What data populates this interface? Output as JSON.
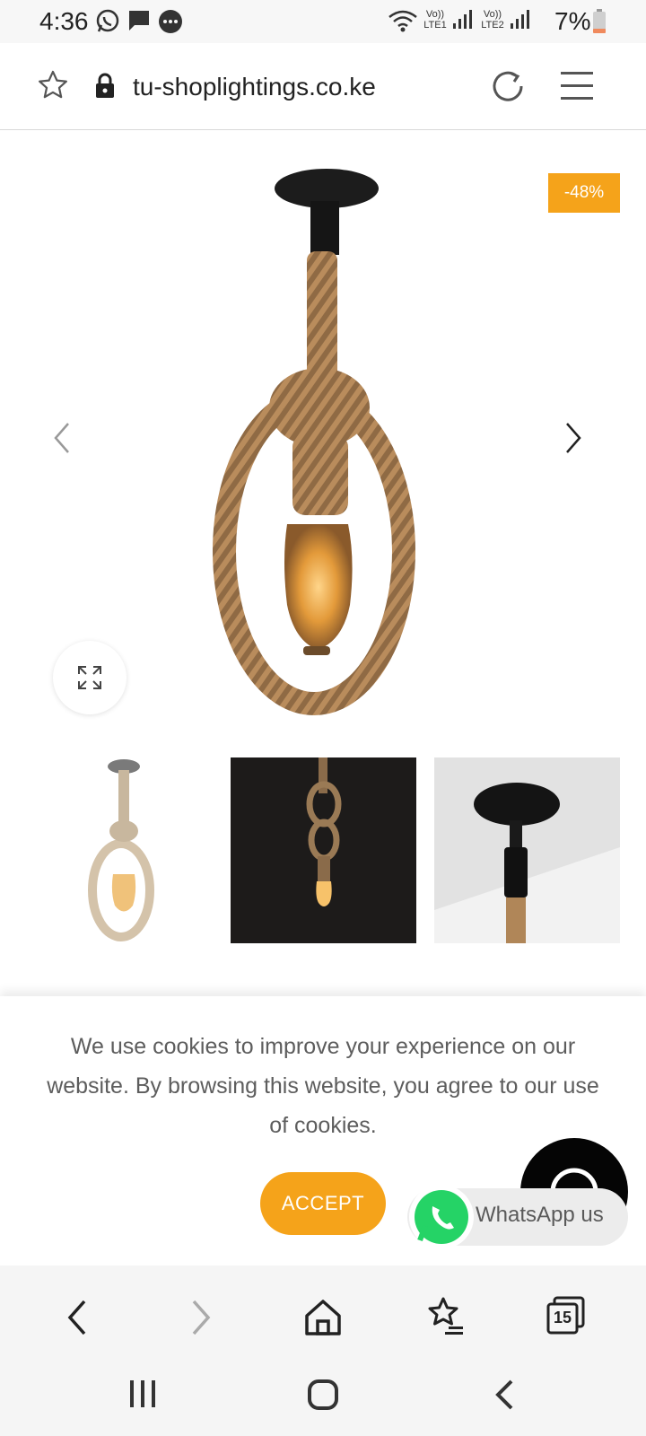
{
  "status_bar": {
    "time": "4:36",
    "network_1": "Vo)) LTE1",
    "network_2": "Vo)) LTE2",
    "battery_percent": "7%"
  },
  "address_bar": {
    "url": "tu-shoplightings.co.ke"
  },
  "product": {
    "discount_badge": "-48%"
  },
  "cookie_banner": {
    "message": "We use cookies to improve your experience on our website. By browsing this website, you agree to our use of cookies.",
    "accept_label": "ACCEPT"
  },
  "whatsapp": {
    "label": "WhatsApp us"
  },
  "browser_toolbar": {
    "tab_count": "15"
  },
  "colors": {
    "accent": "#f5a31a",
    "whatsapp_green": "#25d366"
  },
  "icons": [
    "whatsapp-icon",
    "message-icon",
    "chat-icon",
    "wifi-icon",
    "signal-icon",
    "battery-icon",
    "star-icon",
    "lock-icon",
    "reload-icon",
    "menu-icon",
    "chevron-left-icon",
    "chevron-right-icon",
    "expand-icon",
    "back-icon",
    "forward-icon",
    "home-icon",
    "bookmarks-icon",
    "tabs-icon",
    "recent-apps-icon",
    "home-circle-icon",
    "nav-back-icon"
  ]
}
